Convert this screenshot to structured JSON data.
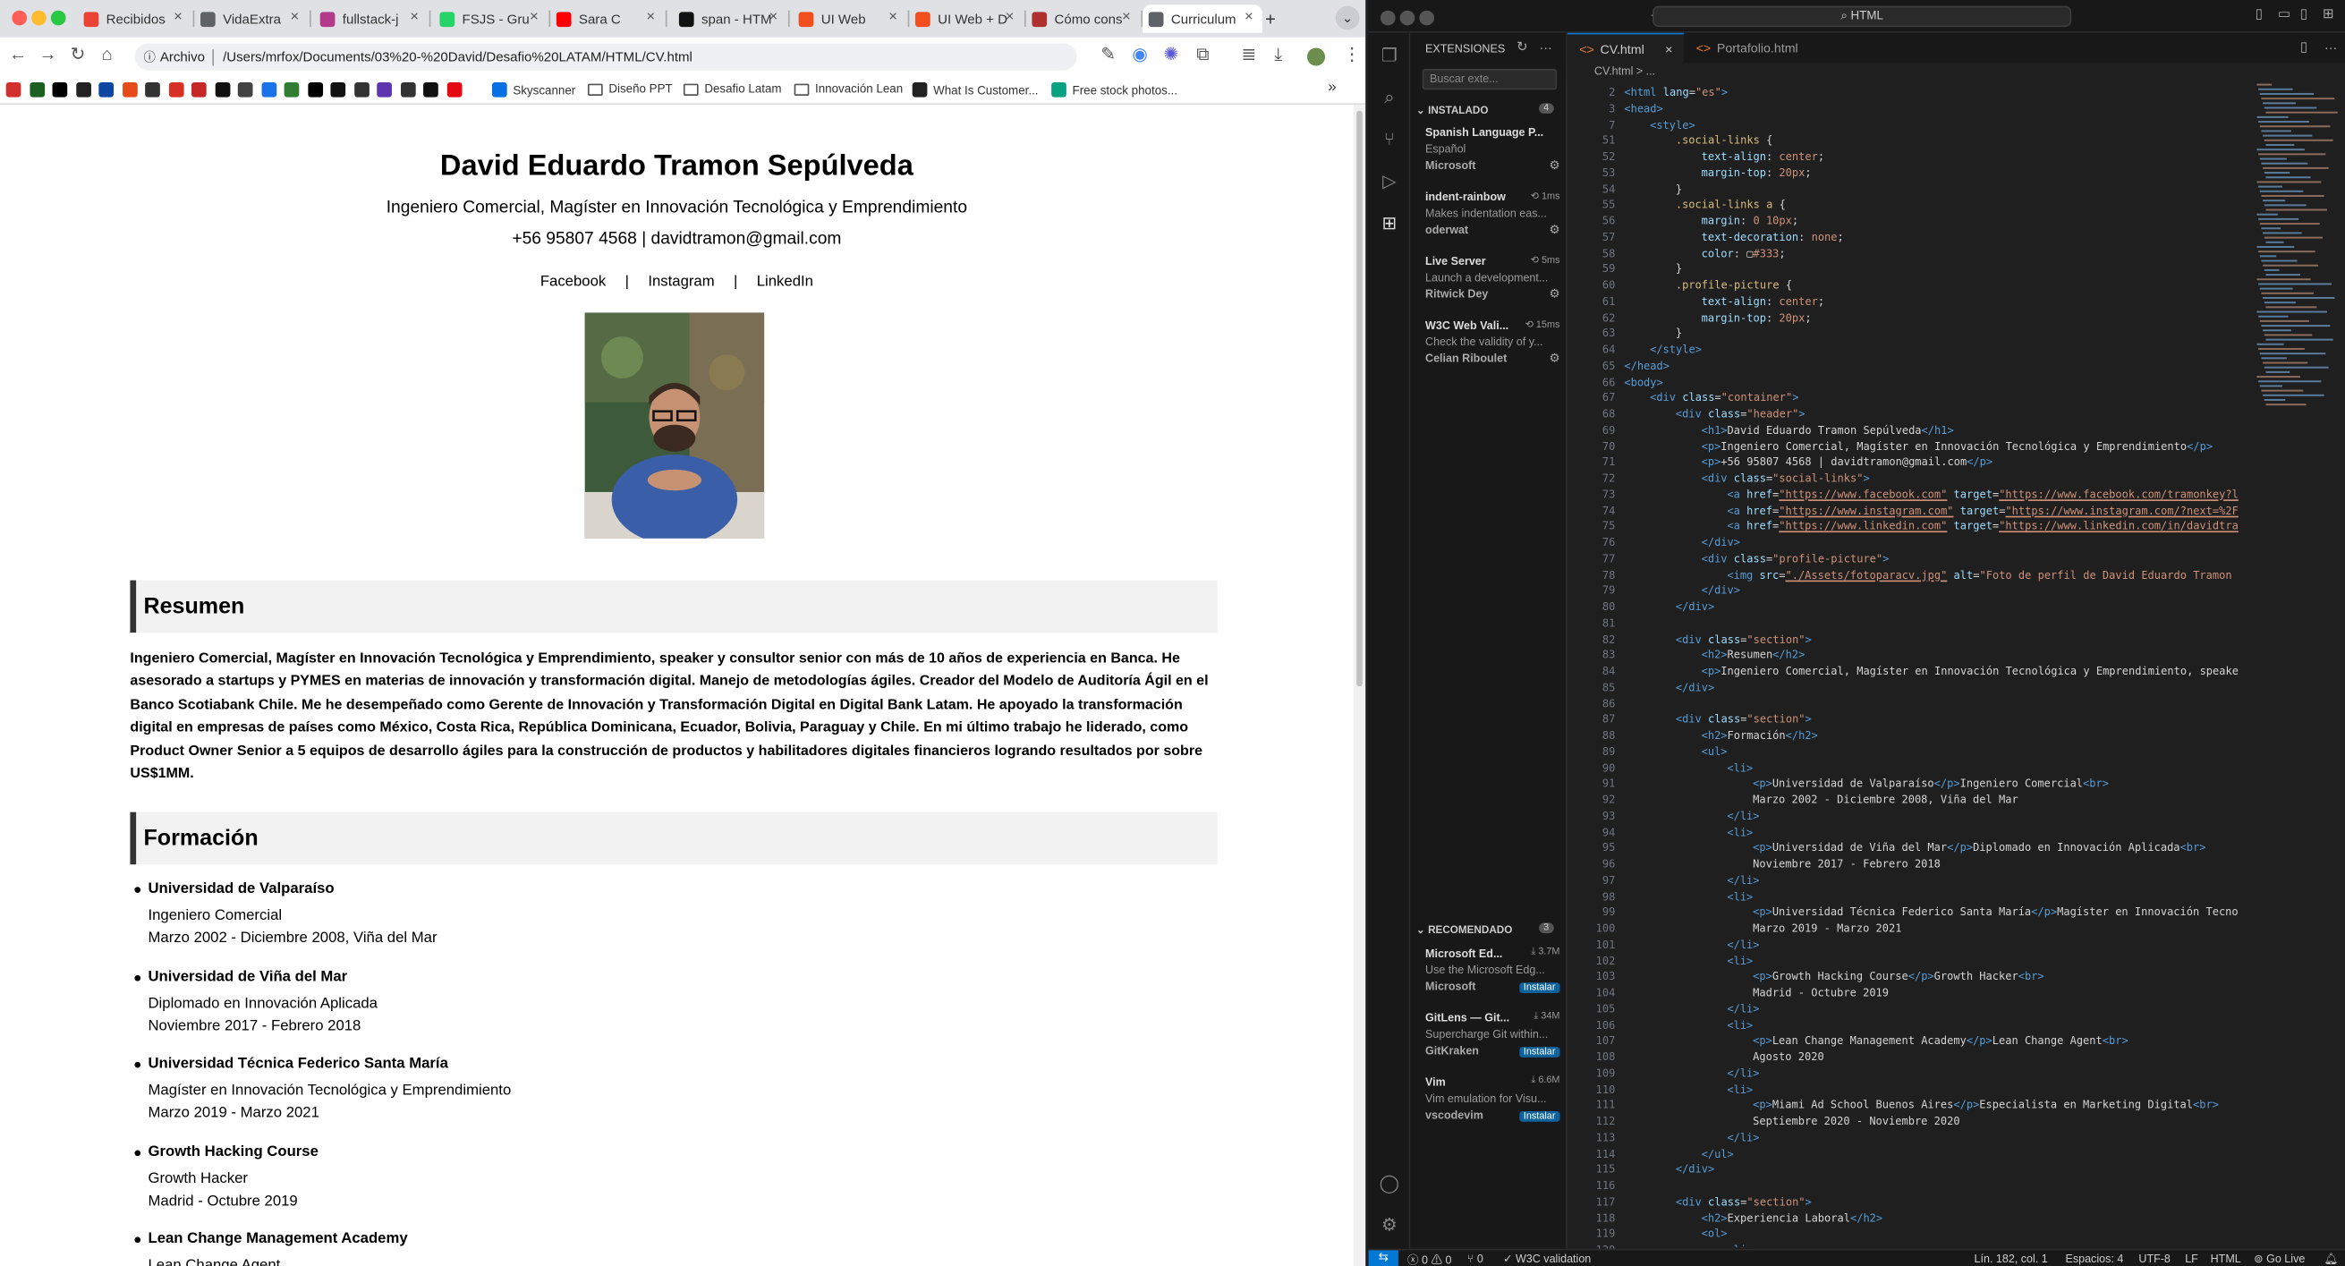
{
  "browser": {
    "tabs": [
      {
        "label": "Recibidos",
        "icon": "gmail-icon",
        "color": "#ea4335"
      },
      {
        "label": "VidaExtra",
        "icon": "vidaextra-icon",
        "color": "#5f6368"
      },
      {
        "label": "fullstack-j",
        "icon": "github-icon",
        "color": "#b4398b"
      },
      {
        "label": "FSJS - Gru",
        "icon": "whatsapp-icon",
        "color": "#25d366"
      },
      {
        "label": "Sara C",
        "icon": "youtube-icon",
        "color": "#ff0000"
      },
      {
        "label": "span - HTM",
        "icon": "mdn-icon",
        "color": "#111111"
      },
      {
        "label": "UI Web",
        "icon": "figma-icon",
        "color": "#f24e1e"
      },
      {
        "label": "UI Web + D",
        "icon": "figma-icon",
        "color": "#f24e1e"
      },
      {
        "label": "Cómo cons",
        "icon": "page-icon",
        "color": "#b03030"
      },
      {
        "label": "Curriculum",
        "icon": "globe-icon",
        "color": "#5f6368"
      }
    ],
    "new_tab": "+",
    "url_chip": "Archivo",
    "url": "/Users/mrfox/Documents/03%20-%20David/Desafio%20LATAM/HTML/CV.html",
    "bookmarks": [
      {
        "label": "Skyscanner"
      },
      {
        "label": "Diseño PPT"
      },
      {
        "label": "Desafio Latam"
      },
      {
        "label": "Innovación Lean"
      },
      {
        "label": "What Is Customer..."
      },
      {
        "label": "Free stock photos..."
      }
    ],
    "more_bookmarks": "»"
  },
  "cv": {
    "name": "David Eduardo Tramon Sepúlveda",
    "title": "Ingeniero Comercial, Magíster en Innovación Tecnológica y Emprendimiento",
    "contact": "+56 95807 4568 | davidtramon@gmail.com",
    "social": [
      "Facebook",
      "Instagram",
      "LinkedIn"
    ],
    "sep": "|",
    "photo_alt": "Foto de perfil de David Eduardo Tramon",
    "resumen_title": "Resumen",
    "resumen_lines": [
      "Ingeniero Comercial, Magíster en Innovación Tecnológica y Emprendimiento, speaker y consultor senior con más de 10 años de experiencia en Banca. He",
      "asesorado a startups y PYMES en materias de innovación y transformación digital. Manejo de metodologías ágiles. Creador del Modelo de Auditoría Ágil en el",
      "Banco Scotiabank Chile. Me he desempeñado como Gerente de Innovación y Transformación Digital en Digital Bank Latam. He apoyado la transformación",
      "digital en empresas de países como México, Costa Rica, República Dominicana, Ecuador, Bolivia, Paraguay y Chile. En mi último trabajo he liderado, como",
      "Product Owner Senior a 5 equipos de desarrollo ágiles para la construcción de productos y habilitadores digitales financieros logrando resultados por sobre",
      "US$1MM."
    ],
    "formacion_title": "Formación",
    "formacion": [
      {
        "school": "Universidad de Valparaíso",
        "degree": "Ingeniero Comercial",
        "dates": "Marzo 2002 - Diciembre 2008, Viña del Mar"
      },
      {
        "school": "Universidad de Viña del Mar",
        "degree": "Diplomado en Innovación Aplicada",
        "dates": "Noviembre 2017 - Febrero 2018"
      },
      {
        "school": "Universidad Técnica Federico Santa María",
        "degree": "Magíster en Innovación Tecnológica y Emprendimiento",
        "dates": "Marzo 2019 - Marzo 2021"
      },
      {
        "school": "Growth Hacking Course",
        "degree": "Growth Hacker",
        "dates": "Madrid - Octubre 2019"
      },
      {
        "school": "Lean Change Management Academy",
        "degree": "Lean Change Agent",
        "dates": ""
      }
    ]
  },
  "vscode": {
    "command_center": "HTML",
    "extensions_title": "EXTENSIONES",
    "search_placeholder": "Buscar exte...",
    "installed_label": "INSTALADO",
    "installed_count": "4",
    "installed": [
      {
        "name": "Spanish Language P...",
        "desc": "Español",
        "publisher": "Microsoft",
        "time": ""
      },
      {
        "name": "indent-rainbow",
        "desc": "Makes indentation eas...",
        "publisher": "oderwat",
        "time": "1ms"
      },
      {
        "name": "Live Server",
        "desc": "Launch a development...",
        "publisher": "Ritwick Dey",
        "time": "5ms"
      },
      {
        "name": "W3C Web Vali...",
        "desc": "Check the validity of y...",
        "publisher": "Celian Riboulet",
        "time": "15ms"
      }
    ],
    "recommended_label": "RECOMENDADO",
    "recommended_count": "3",
    "recommended": [
      {
        "name": "Microsoft Ed...",
        "desc": "Use the Microsoft Edg...",
        "publisher": "Microsoft",
        "downloads": "3.7M",
        "action": "Instalar"
      },
      {
        "name": "GitLens — Git...",
        "desc": "Supercharge Git within...",
        "publisher": "GitKraken",
        "downloads": "34M",
        "action": "Instalar"
      },
      {
        "name": "Vim",
        "desc": "Vim emulation for Visu...",
        "publisher": "vscodevim",
        "downloads": "6.6M",
        "action": "Instalar"
      }
    ],
    "editor_tabs": [
      "CV.html",
      "Portafolio.html"
    ],
    "breadcrumb": "CV.html > ...",
    "status": {
      "errors": "0",
      "warnings": "0",
      "ports": "0",
      "validation": "W3C validation",
      "position": "Lín. 182, col. 1",
      "spaces": "Espacios: 4",
      "encoding": "UTF-8",
      "eol": "LF",
      "language": "HTML",
      "golive": "Go Live"
    }
  }
}
